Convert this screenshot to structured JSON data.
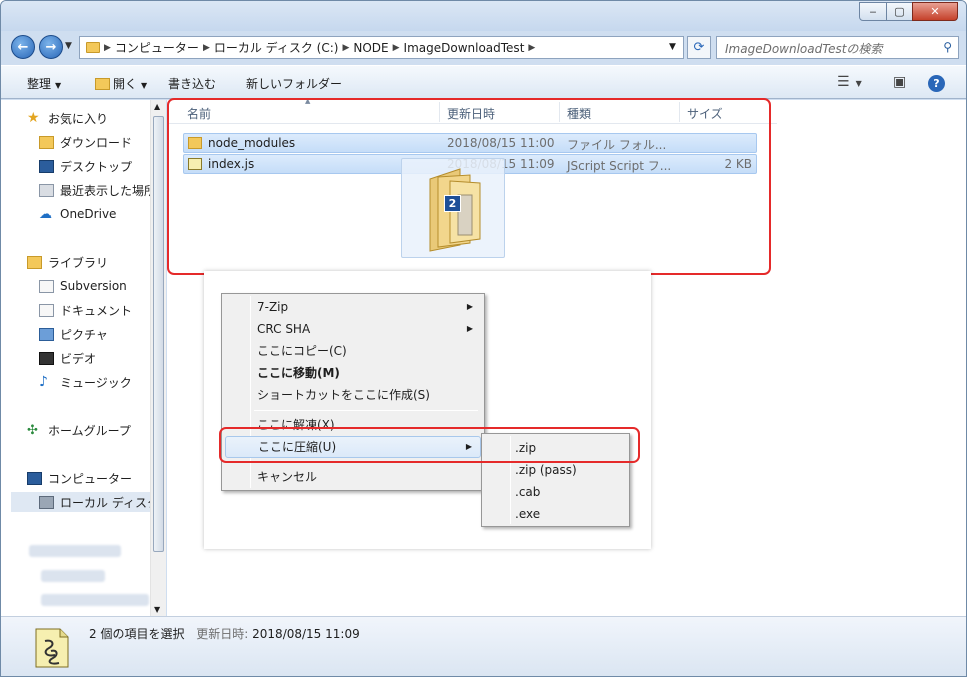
{
  "window": {
    "min": "‒",
    "max": "▢",
    "close": "✕"
  },
  "address": {
    "crumbs": [
      "コンピューター",
      "ローカル ディスク (C:)",
      "NODE",
      "ImageDownloadTest"
    ],
    "search_placeholder": "ImageDownloadTestの検索"
  },
  "toolbar": {
    "organize": "整理",
    "open": "開く",
    "burn": "書き込む",
    "new_folder": "新しいフォルダー",
    "help": "?"
  },
  "nav": {
    "favorites": "お気に入り",
    "downloads": "ダウンロード",
    "desktop": "デスクトップ",
    "recent": "最近表示した場所",
    "onedrive": "OneDrive",
    "libraries": "ライブラリ",
    "subversion": "Subversion",
    "documents": "ドキュメント",
    "pictures": "ピクチャ",
    "videos": "ビデオ",
    "music": "ミュージック",
    "homegroup": "ホームグループ",
    "computer": "コンピューター",
    "local_disk": "ローカル ディスク"
  },
  "columns": {
    "name": "名前",
    "date": "更新日時",
    "type": "種類",
    "size": "サイズ"
  },
  "files": [
    {
      "name": "node_modules",
      "date": "2018/08/15 11:00",
      "type": "ファイル フォル...",
      "size": ""
    },
    {
      "name": "index.js",
      "date": "2018/08/15 11:09",
      "type": "JScript Script フ...",
      "size": "2 KB"
    }
  ],
  "drag": {
    "count": "2"
  },
  "context_menu": {
    "items": [
      "7-Zip",
      "CRC SHA",
      "ここにコピー(C)",
      "ここに移動(M)",
      "ショートカットをここに作成(S)",
      "ここに解凍(X)",
      "ここに圧縮(U)",
      "キャンセル"
    ]
  },
  "submenu": {
    "items": [
      ".zip",
      ".zip (pass)",
      ".cab",
      ".exe"
    ]
  },
  "status": {
    "selection": "2 個の項目を選択",
    "modified_label": "更新日時:",
    "modified_value": "2018/08/15 11:09"
  },
  "colors": {
    "highlight_box": "#e52a2a",
    "selection": "#c5ddf8"
  }
}
